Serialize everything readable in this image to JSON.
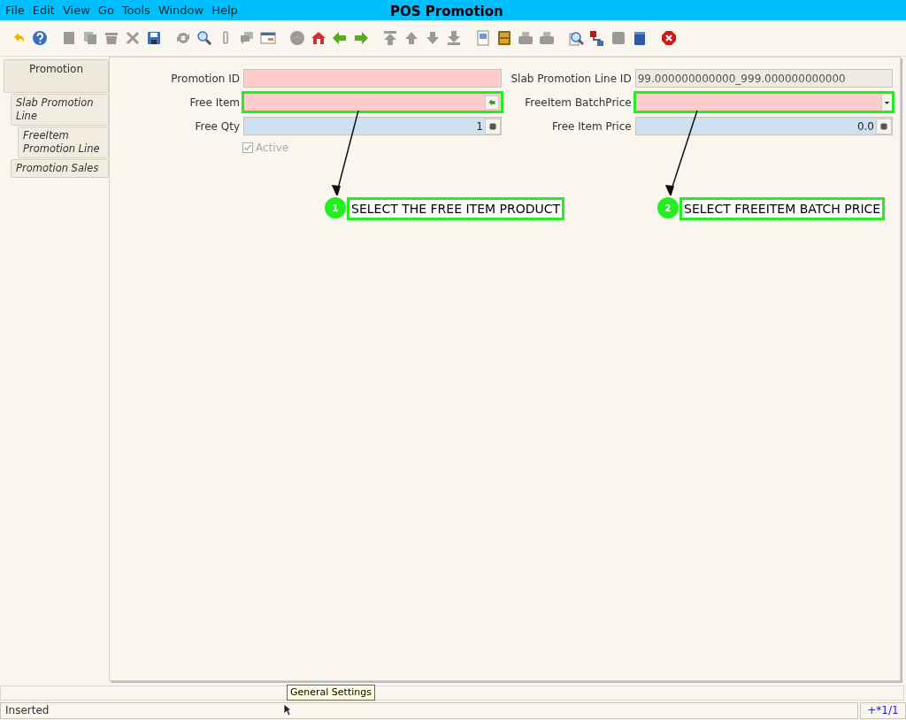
{
  "menu": [
    "File",
    "Edit",
    "View",
    "Go",
    "Tools",
    "Window",
    "Help"
  ],
  "window": {
    "title": "POS Promotion"
  },
  "toolbar": [
    {
      "kind": "undo",
      "disabled": false
    },
    {
      "kind": "help",
      "disabled": false
    },
    {
      "kind": "new",
      "disabled": true
    },
    {
      "kind": "copy",
      "disabled": true
    },
    {
      "kind": "delete",
      "disabled": true
    },
    {
      "kind": "delete-selection",
      "disabled": true
    },
    {
      "kind": "save",
      "disabled": false
    },
    {
      "kind": "refresh",
      "disabled": true
    },
    {
      "kind": "find",
      "disabled": false
    },
    {
      "kind": "attachment",
      "disabled": true
    },
    {
      "kind": "chat",
      "disabled": true
    },
    {
      "kind": "grid",
      "disabled": false
    },
    {
      "kind": "history",
      "disabled": true
    },
    {
      "kind": "home",
      "disabled": false
    },
    {
      "kind": "back",
      "disabled": false
    },
    {
      "kind": "forward",
      "disabled": false
    },
    {
      "kind": "first",
      "disabled": true
    },
    {
      "kind": "previous",
      "disabled": true
    },
    {
      "kind": "next",
      "disabled": true
    },
    {
      "kind": "last",
      "disabled": true
    },
    {
      "kind": "report",
      "disabled": false
    },
    {
      "kind": "archive",
      "disabled": false
    },
    {
      "kind": "print-preview",
      "disabled": true
    },
    {
      "kind": "print",
      "disabled": true
    },
    {
      "kind": "zoom",
      "disabled": false
    },
    {
      "kind": "workflow",
      "disabled": false
    },
    {
      "kind": "product-info",
      "disabled": true
    },
    {
      "kind": "cube",
      "disabled": false
    },
    {
      "kind": "exit",
      "disabled": false
    }
  ],
  "tabs": [
    {
      "label": "Promotion",
      "selected": true
    },
    {
      "label": "Slab Promotion Line",
      "selected": false
    },
    {
      "label": "FreeItem Promotion Line",
      "selected": false
    },
    {
      "label": "Promotion Sales",
      "selected": false
    }
  ],
  "form": {
    "left": [
      {
        "label": "Promotion ID",
        "kind": "text",
        "mandatory": true,
        "readonly": false,
        "highlighted": false
      },
      {
        "label": "Free Item",
        "kind": "search",
        "mandatory": true,
        "readonly": false,
        "highlighted": true
      },
      {
        "label": "Free Qty",
        "value": "1",
        "kind": "number",
        "mandatory": false,
        "readonly": false,
        "highlighted": false
      }
    ],
    "right": [
      {
        "label": "Slab Promotion Line ID",
        "value": "99.000000000000_999.000000000000",
        "kind": "text",
        "mandatory": false,
        "readonly": true,
        "highlighted": false
      },
      {
        "label": "FreeItem BatchPrice",
        "kind": "list",
        "mandatory": true,
        "readonly": false,
        "highlighted": true
      },
      {
        "label": "Free Item Price",
        "value": "0.0",
        "kind": "number",
        "mandatory": false,
        "readonly": false,
        "highlighted": false
      }
    ],
    "checkbox": {
      "label": "Active",
      "checked": true,
      "disabled": true
    }
  },
  "annotations": [
    {
      "number": "1",
      "text": "SELECT THE FREE ITEM PRODUCT"
    },
    {
      "number": "2",
      "text": "SELECT FREEITEM BATCH PRICE"
    }
  ],
  "tooltip": "General Settings",
  "status_bar": {
    "message": "Inserted",
    "record": "+*1/1"
  }
}
